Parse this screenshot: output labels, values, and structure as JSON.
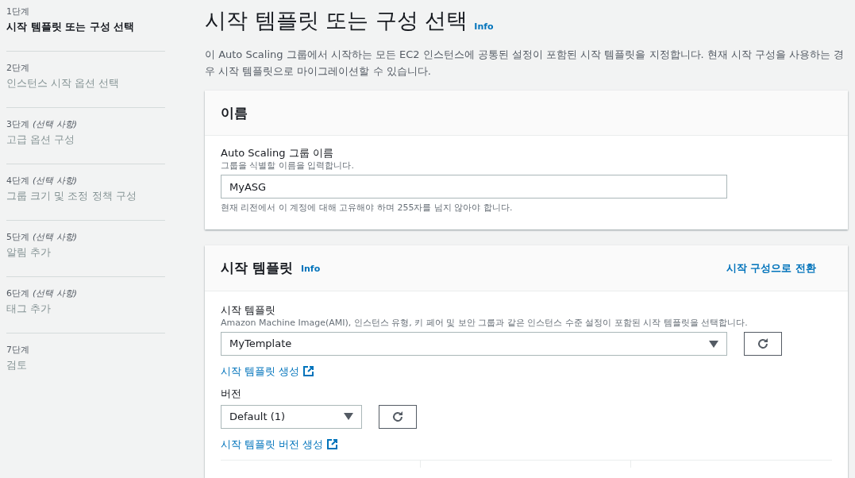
{
  "steps": [
    {
      "number": "1단계",
      "title": "시작 템플릿 또는 구성 선택",
      "selected": true
    },
    {
      "number": "2단계",
      "title": "인스턴스 시작 옵션 선택",
      "selected": false
    },
    {
      "number": "3단계",
      "optional": "(선택 사항)",
      "title": "고급 옵션 구성",
      "selected": false
    },
    {
      "number": "4단계",
      "optional": "(선택 사항)",
      "title": "그룹 크기 및 조정 정책 구성",
      "selected": false
    },
    {
      "number": "5단계",
      "optional": "(선택 사항)",
      "title": "알림 추가",
      "selected": false
    },
    {
      "number": "6단계",
      "optional": "(선택 사항)",
      "title": "태그 추가",
      "selected": false
    },
    {
      "number": "7단계",
      "title": "검토",
      "selected": false
    }
  ],
  "page": {
    "title": "시작 템플릿 또는 구성 선택",
    "info": "Info",
    "description": "이 Auto Scaling 그룹에서 시작하는 모든 EC2 인스턴스에 공통된 설정이 포함된 시작 템플릿을 지정합니다. 현재 시작 구성을 사용하는 경우 시작 템플릿으로 마이그레이션할 수 있습니다."
  },
  "name_panel": {
    "title": "이름",
    "label": "Auto Scaling 그룹 이름",
    "hint": "그룹을 식별할 이름을 입력합니다.",
    "value": "MyASG",
    "constraint": "현재 리전에서 이 계정에 대해 고유해야 하며 255자를 넘지 않아야 합니다."
  },
  "template_panel": {
    "title": "시작 템플릿",
    "info": "Info",
    "switch_link": "시작 구성으로 전환",
    "template_label": "시작 템플릿",
    "template_hint": "Amazon Machine Image(AMI), 인스턴스 유형, 키 페어 및 보안 그룹과 같은 인스턴스 수준 설정이 포함된 시작 템플릿을 선택합니다.",
    "template_value": "MyTemplate",
    "create_template_link": "시작 템플릿 생성",
    "version_label": "버전",
    "version_value": "Default (1)",
    "create_version_link": "시작 템플릿 버전 생성"
  }
}
